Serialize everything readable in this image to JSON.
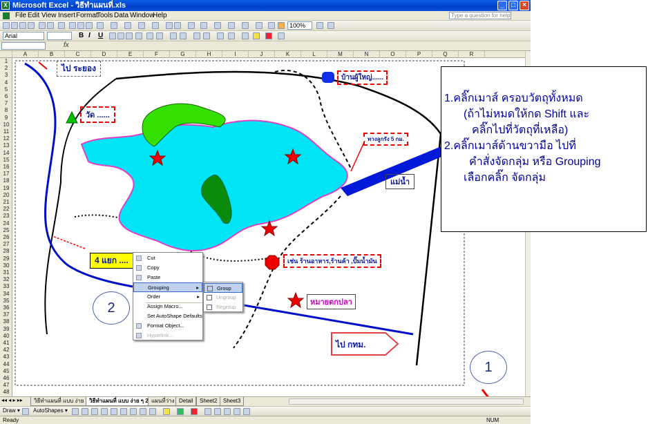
{
  "window": {
    "title": "Microsoft Excel - วิธีทำแผนที่.xls",
    "app_icon": "X",
    "min": "_",
    "max": "□",
    "close": "×"
  },
  "menu": {
    "items": [
      "File",
      "Edit",
      "View",
      "Insert",
      "Format",
      "Tools",
      "Data",
      "Window",
      "Help"
    ],
    "ask": "Type a question for help"
  },
  "toolbar": {
    "font": "Arial",
    "zoom": "100%",
    "bold": "B",
    "italic": "I",
    "underline": "U"
  },
  "formula": {
    "fx": "fx"
  },
  "columns": [
    "A",
    "B",
    "C",
    "D",
    "E",
    "F",
    "G",
    "H",
    "I",
    "J",
    "K",
    "L",
    "M",
    "N",
    "O",
    "P",
    "Q",
    "R"
  ],
  "rows": [
    "1",
    "2",
    "3",
    "4",
    "5",
    "6",
    "7",
    "8",
    "9",
    "10",
    "11",
    "12",
    "13",
    "14",
    "15",
    "16",
    "17",
    "18",
    "19",
    "20",
    "21",
    "22",
    "23",
    "24",
    "25",
    "26",
    "27",
    "28",
    "29",
    "30",
    "31",
    "32",
    "33",
    "34",
    "35",
    "36",
    "37",
    "38",
    "39",
    "40",
    "41",
    "42",
    "43",
    "44",
    "45",
    "46",
    "47",
    "48"
  ],
  "map": {
    "to_rayong": "ไป ระยอง",
    "temple": "วัด ......",
    "village_head": "บ้านผู้ใหญ่......",
    "road_sign": "ทางลูกรัง 5 กม.",
    "river": "แม่น้ำ",
    "intersection": "4 แยก ....",
    "shops": "เช่น ร้านอาหาร,ร้านค้า ,ปั๊มน้ำมัน",
    "fish_village": "หมายตกปลา",
    "to_bangkok": "ไป กทม."
  },
  "note": {
    "line1": "1.คลิ๊กเมาส์ ครอบวัตถุทั้งหมด",
    "line2": "(ถ้าไม่หมดให้กด Shift และ",
    "line3": "คลิ๊กไปที่วัตถุที่เหลือ)",
    "line4": "2.คลิ๊กเมาส์ด้านขวามือ ไปที่",
    "line5": "คำสั่งจัดกลุ่ม หรือ Grouping",
    "line6": "เลือกคลิ๊ก จัดกลุ่ม"
  },
  "markers": {
    "one": "1",
    "two": "2"
  },
  "context_menu": {
    "items": [
      "Cut",
      "Copy",
      "Paste",
      "Grouping",
      "Order",
      "Assign Macro...",
      "Set AutoShape Defaults",
      "Format Object...",
      "Hyperlink..."
    ],
    "sub": [
      "Group",
      "Ungroup",
      "Regroup"
    ]
  },
  "tabs": [
    "วิธีทำแผนที่ แบบ ง่าย ๆ",
    "วิธีทำแผนที่ แบบ ง่าย ๆ 2",
    "แผนที่ว่าง",
    "Detail",
    "Sheet2",
    "Sheet3"
  ],
  "drawbar": {
    "draw": "Draw ▾",
    "autoshapes": "AutoShapes ▾"
  },
  "status": {
    "left": "Ready",
    "right": "NUM"
  }
}
